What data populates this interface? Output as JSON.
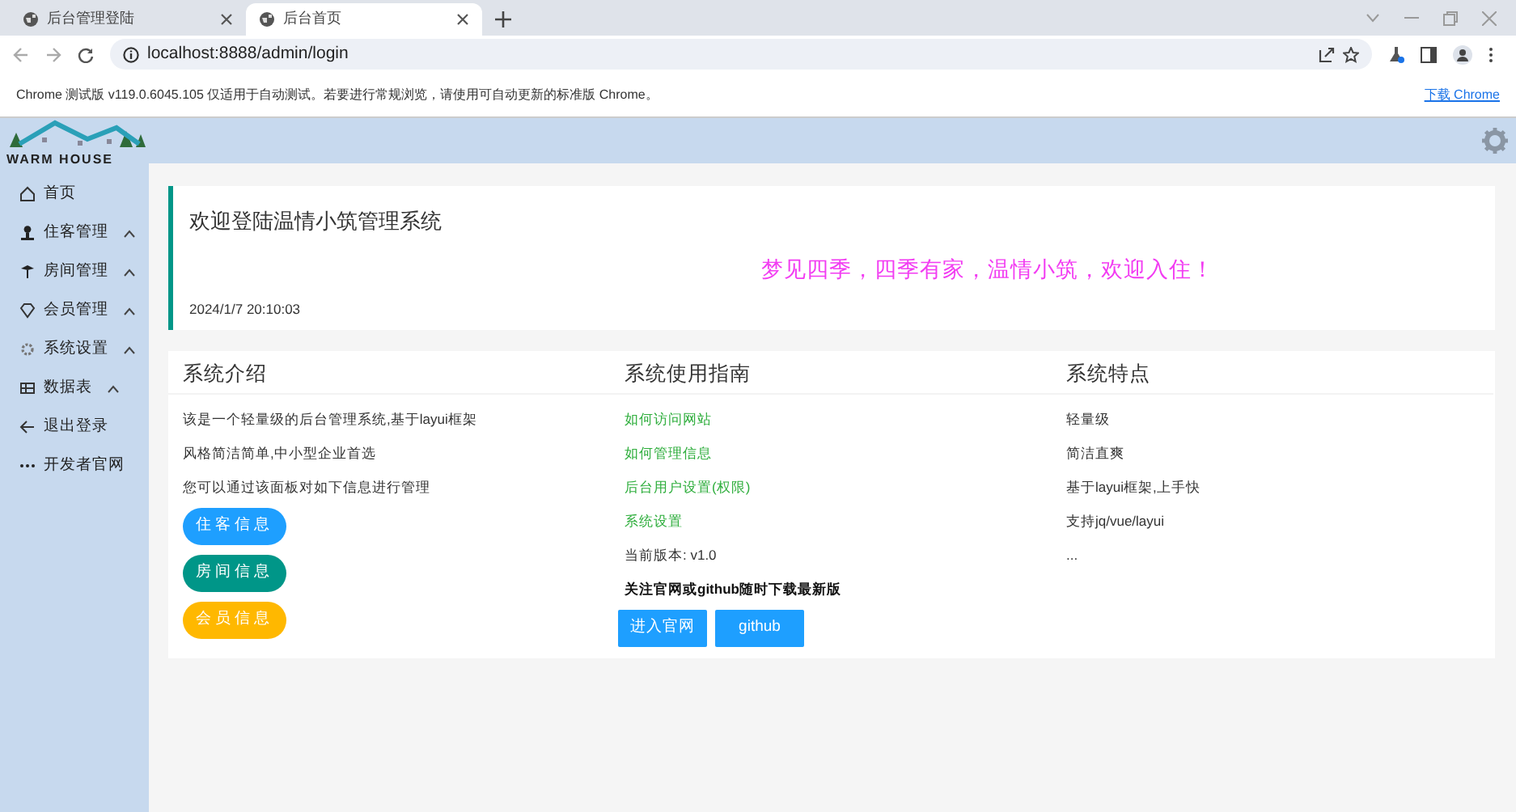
{
  "browser": {
    "tabs": [
      {
        "title": "后台管理登陆",
        "selected": false
      },
      {
        "title": "后台首页",
        "selected": true
      }
    ],
    "url": "localhost:8888/admin/login",
    "infobar": {
      "message": "Chrome 测试版 v119.0.6045.105 仅适用于自动测试。若要进行常规浏览，请使用可自动更新的标准版 Chrome。",
      "link": "下载 Chrome"
    }
  },
  "logo": {
    "text": "WARM HOUSE"
  },
  "sidebar": {
    "items": [
      {
        "label": "首页",
        "kind": "link"
      },
      {
        "label": "住客管理",
        "kind": "group"
      },
      {
        "label": "房间管理",
        "kind": "group"
      },
      {
        "label": "会员管理",
        "kind": "group"
      },
      {
        "label": "系统设置",
        "kind": "group"
      },
      {
        "label": "数据表",
        "kind": "group"
      },
      {
        "label": "退出登录",
        "kind": "link"
      },
      {
        "label": "开发者官网",
        "kind": "link"
      }
    ]
  },
  "welcome": {
    "title": "欢迎登陆温情小筑管理系统",
    "slogan": "梦见四季，四季有家，温情小筑，欢迎入住！",
    "time": "2024/1/7 20:10:03"
  },
  "panels": [
    {
      "title": "系统介绍",
      "lines": [
        {
          "text": "该是一个轻量级的后台管理系统,基于layui框架",
          "kind": "plain"
        },
        {
          "text": "风格简洁简单,中小型企业首选",
          "kind": "plain"
        },
        {
          "text": "您可以通过该面板对如下信息进行管理",
          "kind": "plain"
        }
      ],
      "buttons": [
        {
          "label": "住客信息",
          "color": "#1e9fff",
          "kind": "pill"
        },
        {
          "label": "房间信息",
          "color": "#009688",
          "kind": "pill"
        },
        {
          "label": "会员信息",
          "color": "#ffb800",
          "kind": "pill"
        }
      ]
    },
    {
      "title": "系统使用指南",
      "lines": [
        {
          "text": "如何访问网站",
          "kind": "link"
        },
        {
          "text": "如何管理信息",
          "kind": "link"
        },
        {
          "text": "后台用户设置(权限)",
          "kind": "link"
        },
        {
          "text": "系统设置",
          "kind": "link"
        },
        {
          "text": "当前版本: v1.0",
          "kind": "plain"
        },
        {
          "text": "关注官网或github随时下载最新版",
          "kind": "bold"
        }
      ],
      "buttons": [
        {
          "label": "进入官网",
          "color": "#1e9fff",
          "kind": "square"
        },
        {
          "label": "github",
          "color": "#1e9fff",
          "kind": "square"
        }
      ]
    },
    {
      "title": "系统特点",
      "lines": [
        {
          "text": "轻量级",
          "kind": "plain"
        },
        {
          "text": "简洁直爽",
          "kind": "plain"
        },
        {
          "text": "基于layui框架,上手快",
          "kind": "plain"
        },
        {
          "text": "支持jq/vue/layui",
          "kind": "plain"
        },
        {
          "text": "...",
          "kind": "plain"
        }
      ]
    }
  ]
}
